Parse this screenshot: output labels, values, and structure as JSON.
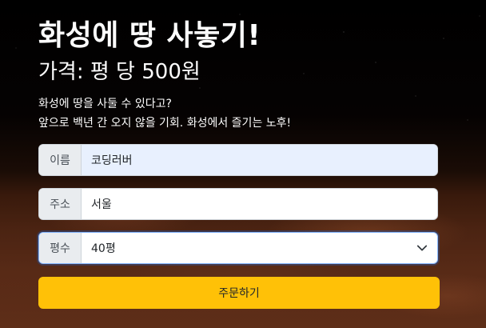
{
  "header": {
    "title": "화성에 땅 사놓기!",
    "subtitle": "가격: 평 당 500원"
  },
  "description": {
    "line1": "화성에 땅을 사둘 수 있다고?",
    "line2": "앞으로 백년 간 오지 않을 기회. 화성에서 즐기는 노후!"
  },
  "form": {
    "name_label": "이름",
    "name_value": "코딩러버",
    "address_label": "주소",
    "address_value": "서울",
    "size_label": "평수",
    "size_selected": "40평",
    "order_button": "주문하기"
  },
  "colors": {
    "button": "#ffc107",
    "autofill": "#e8f0fe"
  },
  "icons": {
    "select_chevron": "chevron-down-icon"
  }
}
